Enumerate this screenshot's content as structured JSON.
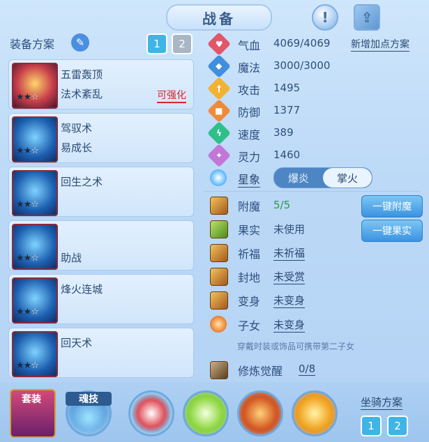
{
  "header": {
    "title": "战备"
  },
  "left": {
    "heading": "装备方案",
    "plan_buttons": [
      "1",
      "2"
    ],
    "cards": [
      {
        "line1": "五雷轰顶",
        "line2": "法术紊乱",
        "badge": "可强化",
        "stars_filled": 2,
        "stars_total": 3
      },
      {
        "line1": "驾驭术",
        "line2": "易成长",
        "badge": "",
        "stars_filled": 2,
        "stars_total": 3
      },
      {
        "line1": "回生之术",
        "line2": "",
        "badge": "",
        "stars_filled": 2,
        "stars_total": 3
      },
      {
        "line1": "",
        "line2": "助战",
        "badge": "",
        "stars_filled": 2,
        "stars_total": 3
      },
      {
        "line1": "烽火连城",
        "line2": "",
        "badge": "",
        "stars_filled": 2,
        "stars_total": 3
      },
      {
        "line1": "回天术",
        "line2": "",
        "badge": "",
        "stars_filled": 2,
        "stars_total": 3
      }
    ]
  },
  "stats": [
    {
      "label": "气血",
      "value": "4069/4069",
      "color": "#e2566a",
      "icon": "heart-icon"
    },
    {
      "label": "魔法",
      "value": "3000/3000",
      "color": "#3f8ee0",
      "icon": "magic-icon"
    },
    {
      "label": "攻击",
      "value": "1495",
      "color": "#f2b233",
      "icon": "sword-icon"
    },
    {
      "label": "防御",
      "value": "1377",
      "color": "#f08a3a",
      "icon": "shield-icon"
    },
    {
      "label": "速度",
      "value": "389",
      "color": "#2fbf8a",
      "icon": "lightning-icon"
    },
    {
      "label": "灵力",
      "value": "1460",
      "color": "#c277d8",
      "icon": "spirit-icon"
    }
  ],
  "add_points_link": "新增加点方案",
  "star_sign": {
    "label": "星象",
    "options": [
      "爆炎",
      "掌火"
    ],
    "selected": "掌火"
  },
  "extras": [
    {
      "label": "附魔",
      "value": "5/5",
      "value_color": "#2aa02a"
    },
    {
      "label": "果实",
      "value": "未使用"
    },
    {
      "label": "祈福",
      "value": "未祈福"
    },
    {
      "label": "封地",
      "value": "未受赏"
    },
    {
      "label": "变身",
      "value": "未变身"
    },
    {
      "label": "子女",
      "value": "未变身"
    }
  ],
  "buttons": {
    "enchant_all": "一键附魔",
    "fruit_all": "一键果实"
  },
  "note": "穿戴时装或饰品可携带第二子女",
  "cultivation": {
    "label": "修炼觉醒",
    "value": "0/8"
  },
  "bottom": {
    "suit_label": "套装",
    "soul_label": "魂技",
    "mount_label": "坐骑方案",
    "mount_buttons": [
      "1",
      "2"
    ]
  }
}
